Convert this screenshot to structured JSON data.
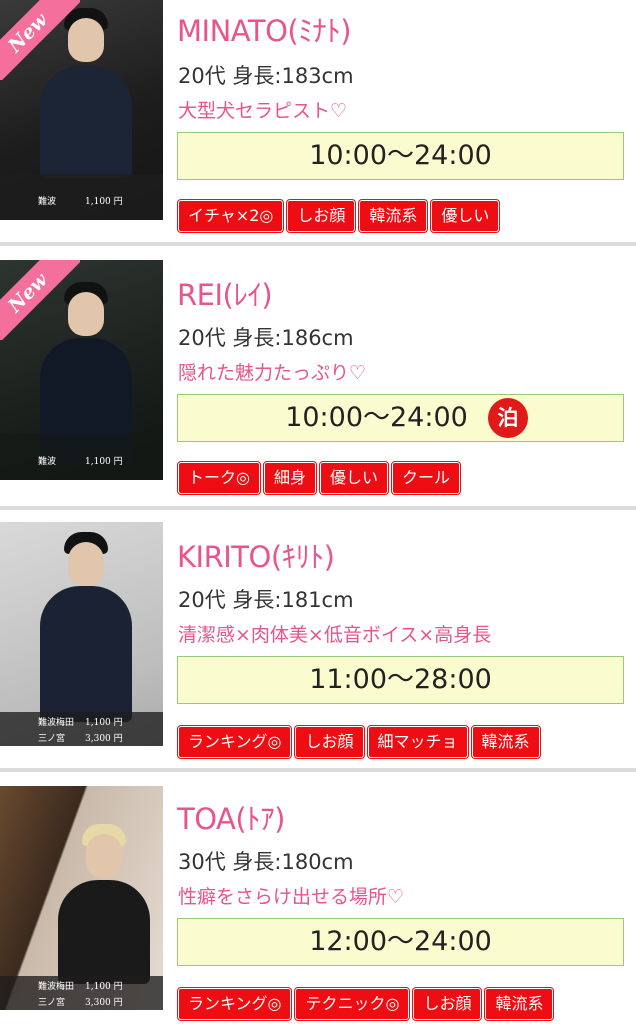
{
  "new_label": "New",
  "colors": {
    "name_pink": "#e8548c",
    "tag_red": "#ee0d12",
    "hours_bg": "#fbfbd0",
    "hours_border": "#9ac97a"
  },
  "therapists": [
    {
      "name": "MINATO(ﾐﾅﾄ)",
      "info": "20代 身長:183cm",
      "catch": "大型犬セラピスト♡",
      "hours": "10:00〜24:00",
      "overnight": "",
      "is_new": true,
      "prices": [
        {
          "station": "難波",
          "price": "1,100 円"
        }
      ],
      "tags": [
        "イチャ×2◎",
        "しお顔",
        "韓流系",
        "優しい"
      ]
    },
    {
      "name": "REI(ﾚｲ)",
      "info": "20代 身長:186cm",
      "catch": "隠れた魅力たっぷり♡",
      "hours": "10:00〜24:00",
      "overnight": "泊",
      "is_new": true,
      "prices": [
        {
          "station": "難波",
          "price": "1,100 円"
        }
      ],
      "tags": [
        "トーク◎",
        "細身",
        "優しい",
        "クール"
      ]
    },
    {
      "name": "KIRITO(ｷﾘﾄ)",
      "info": "20代 身長:181cm",
      "catch": "清潔感×肉体美×低音ボイス×高身長",
      "hours": "11:00〜28:00",
      "overnight": "",
      "is_new": false,
      "prices": [
        {
          "station": "難波梅田",
          "price": "1,100 円"
        },
        {
          "station": "三ノ宮",
          "price": "3,300 円"
        }
      ],
      "tags": [
        "ランキング◎",
        "しお顔",
        "細マッチョ",
        "韓流系"
      ]
    },
    {
      "name": "TOA(ﾄｱ)",
      "info": "30代 身長:180cm",
      "catch": "性癖をさらけ出せる場所♡",
      "hours": "12:00〜24:00",
      "overnight": "",
      "is_new": false,
      "prices": [
        {
          "station": "難波梅田",
          "price": "1,100 円"
        },
        {
          "station": "三ノ宮",
          "price": "3,300 円"
        }
      ],
      "tags": [
        "ランキング◎",
        "テクニック◎",
        "しお顔",
        "韓流系"
      ]
    }
  ]
}
